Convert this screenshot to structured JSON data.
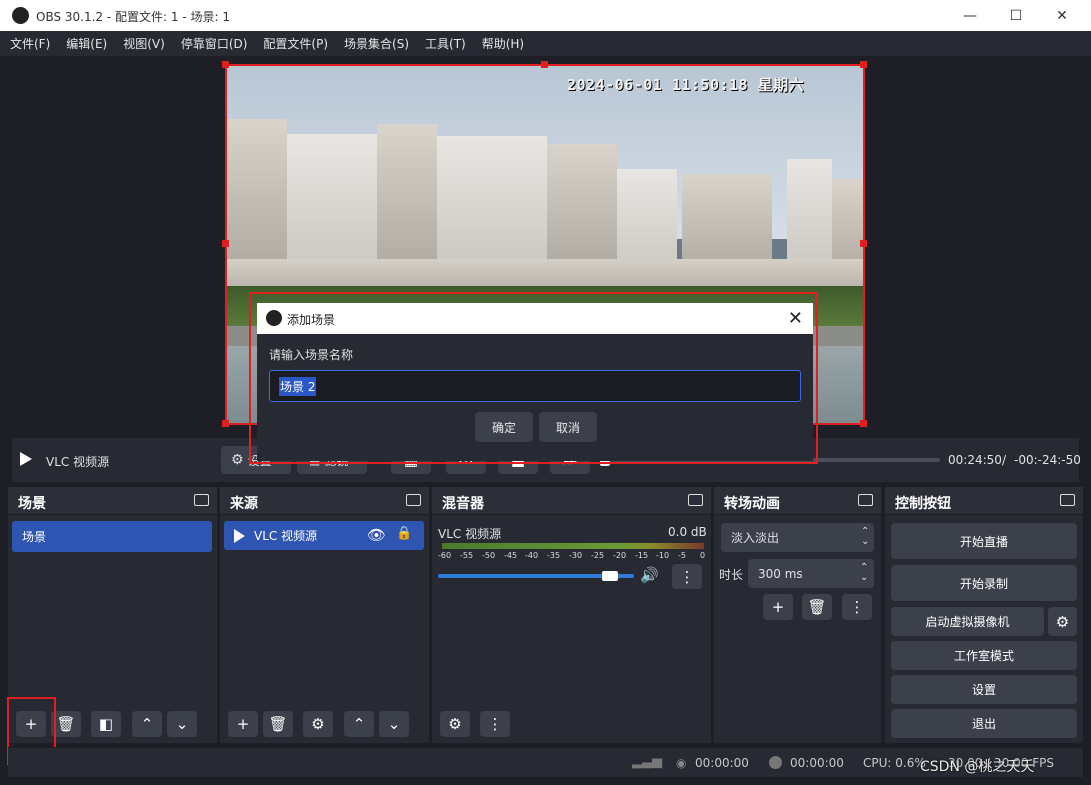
{
  "window": {
    "title": "OBS 30.1.2 - 配置文件: 1 - 场景: 1"
  },
  "menu": [
    "文件(F)",
    "编辑(E)",
    "视图(V)",
    "停靠窗口(D)",
    "配置文件(P)",
    "场景集合(S)",
    "工具(T)",
    "帮助(H)"
  ],
  "preview": {
    "osd_text": "2024-06-01  11:50:18 星期六"
  },
  "dialog": {
    "title": "添加场景",
    "prompt": "请输入场景名称",
    "input_value": "场景 2",
    "ok_label": "确定",
    "cancel_label": "取消"
  },
  "media": {
    "source_name": "VLC 视频源",
    "settings_label": "设置",
    "filters_label": "滤镜",
    "time_elapsed": "00:24:50",
    "time_sep": "/",
    "time_remaining": "-00:-24:-50"
  },
  "docks": {
    "scenes": {
      "title": "场景",
      "items": [
        "场景"
      ]
    },
    "sources": {
      "title": "来源",
      "items": [
        "VLC 视频源"
      ]
    },
    "mixer": {
      "title": "混音器",
      "channel": "VLC 视频源",
      "level": "0.0 dB",
      "scale": [
        "-60",
        "-55",
        "-50",
        "-45",
        "-40",
        "-35",
        "-30",
        "-25",
        "-20",
        "-15",
        "-10",
        "-5",
        "0"
      ],
      "volume": 0.92
    },
    "transitions": {
      "title": "转场动画",
      "selected": "淡入淡出",
      "duration_label": "时长",
      "duration_value": "300 ms"
    },
    "controls": {
      "title": "控制按钮",
      "buttons": [
        "开始直播",
        "开始录制",
        "启动虚拟摄像机",
        "工作室模式",
        "设置",
        "退出"
      ]
    }
  },
  "status": {
    "stream_time": "00:00:00",
    "rec_time": "00:00:00",
    "cpu": "CPU: 0.6%",
    "fps": "30.00 / 30.00 FPS",
    "watermark": "CSDN @桃之夭夭"
  }
}
